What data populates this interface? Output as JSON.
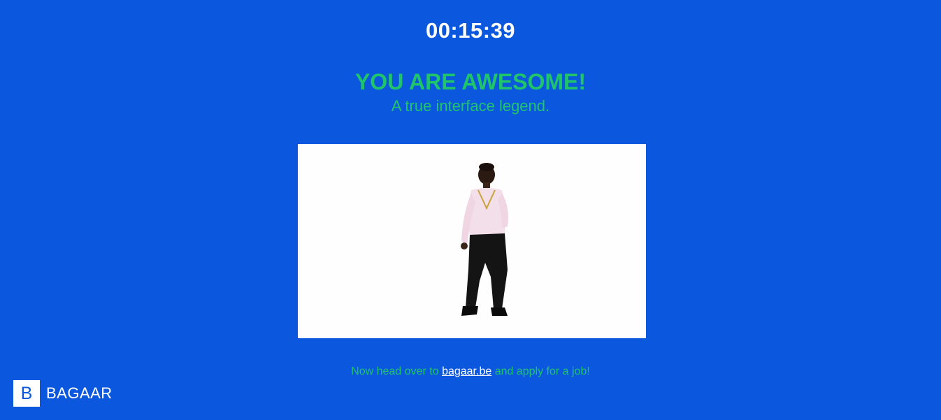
{
  "timer": {
    "value": "00:15:39"
  },
  "message": {
    "headline": "YOU ARE AWESOME!",
    "subline": "A true interface legend."
  },
  "media": {
    "icon": "dancing-man-image"
  },
  "footer": {
    "prefix": "Now head over to ",
    "link_text": "bagaar.be",
    "suffix": " and apply for a job!"
  },
  "logo": {
    "mark": "B",
    "wordmark": "BAGAAR"
  },
  "colors": {
    "background": "#0b57dd",
    "accent_green": "#1fc46b",
    "text_white": "#ffffff"
  }
}
